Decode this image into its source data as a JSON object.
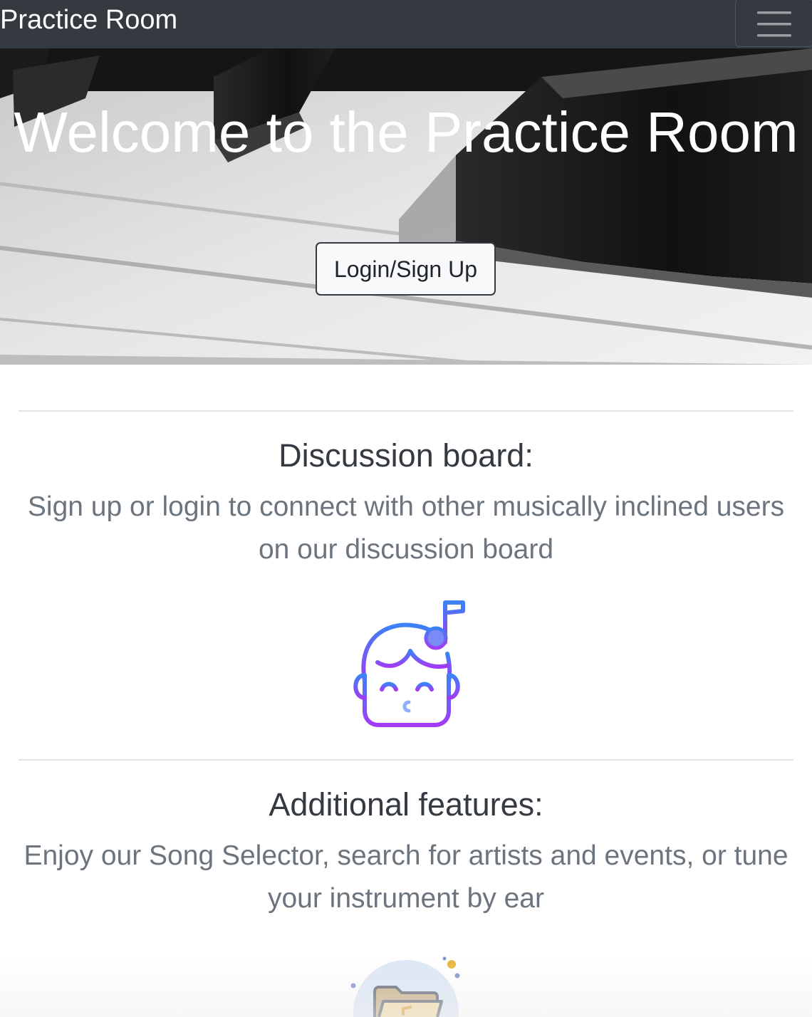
{
  "navbar": {
    "brand": "Practice Room",
    "toggle_icon": "hamburger-menu-icon"
  },
  "hero": {
    "title": "Welcome to the Practice Room",
    "login_button": "Login/Sign Up"
  },
  "sections": [
    {
      "title": "Discussion board:",
      "text": "Sign up or login to connect with other musically inclined users on our discussion board",
      "icon": "singing-child-icon"
    },
    {
      "title": "Additional features:",
      "text": "Enjoy our Song Selector, search for artists and events, or tune your instrument by ear",
      "icon": "music-folder-icon"
    }
  ],
  "colors": {
    "navbar_bg": "#343a40",
    "section_title": "#343a40",
    "section_text": "#6c757d",
    "icon_gradient_start": "#3b82f6",
    "icon_gradient_end": "#a23bf5"
  }
}
